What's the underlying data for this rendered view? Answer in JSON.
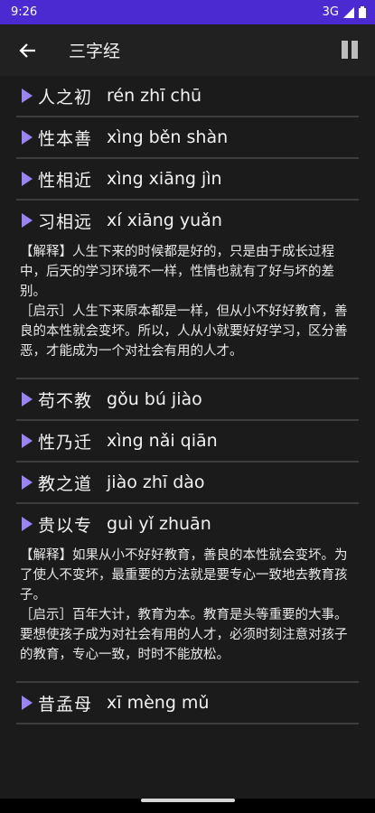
{
  "status": {
    "time": "9:26",
    "network": "3G"
  },
  "toolbar": {
    "title": "三字经"
  },
  "verses": [
    {
      "hanzi": "人之初",
      "pinyin": "rén zhī chū"
    },
    {
      "hanzi": "性本善",
      "pinyin": "xìng běn shàn"
    },
    {
      "hanzi": "性相近",
      "pinyin": "xìng xiāng jìn"
    },
    {
      "hanzi": "习相远",
      "pinyin": "xí xiāng yuǎn",
      "explain": "【解释】人生下来的时候都是好的，只是由于成长过程中，后天的学习环境不一样，性情也就有了好与坏的差别。",
      "insight": "［启示］人生下来原本都是一样，但从小不好好教育，善良的本性就会变坏。所以，人从小就要好好学习，区分善恶，才能成为一个对社会有用的人才。"
    },
    {
      "hanzi": "苟不教",
      "pinyin": "gǒu bú jiào"
    },
    {
      "hanzi": "性乃迁",
      "pinyin": "xìng nǎi qiān"
    },
    {
      "hanzi": "教之道",
      "pinyin": "jiào zhī dào"
    },
    {
      "hanzi": "贵以专",
      "pinyin": "guì yǐ zhuān",
      "explain": "【解释】如果从小不好好教育，善良的本性就会变坏。为了使人不变坏，最重要的方法就是要专心一致地去教育孩子。",
      "insight": "［启示］百年大计，教育为本。教育是头等重要的大事。要想使孩子成为对社会有用的人才，必须时刻注意对孩子的教育，专心一致，时时不能放松。"
    },
    {
      "hanzi": "昔孟母",
      "pinyin": "xī mèng mǔ"
    }
  ]
}
